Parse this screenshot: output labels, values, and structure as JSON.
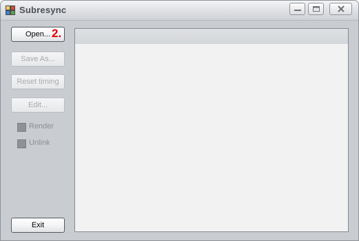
{
  "window": {
    "title": "Subresync",
    "controls": {
      "minimize_icon": "minimize-icon",
      "maximize_icon": "maximize-icon",
      "close_icon": "close-icon"
    }
  },
  "buttons": {
    "open": "Open...",
    "open_annotation": "2.",
    "save_as": "Save As...",
    "reset_timing": "Reset timing",
    "edit": "Edit...",
    "exit": "Exit"
  },
  "checkboxes": {
    "render": "Render",
    "unlink": "Unlink"
  },
  "colors": {
    "window_bg": "#c9ccd1",
    "annotation": "#e00000",
    "disabled_text": "#a7aaaf"
  }
}
